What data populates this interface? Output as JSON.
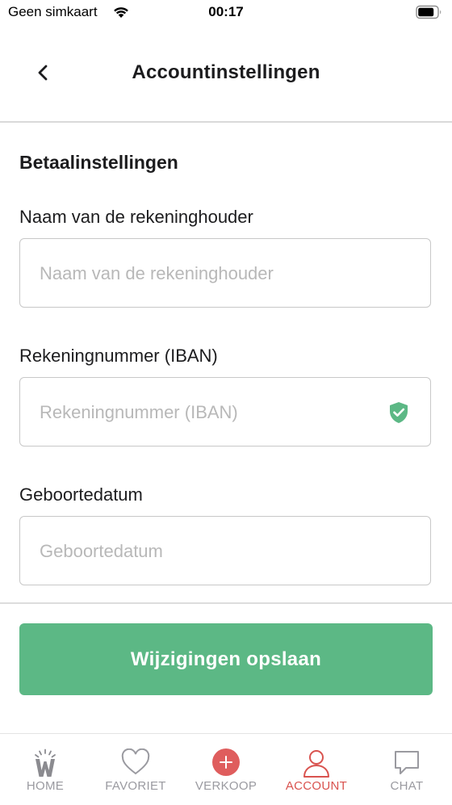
{
  "status_bar": {
    "carrier": "Geen simkaart",
    "time": "00:17"
  },
  "header": {
    "title": "Accountinstellingen",
    "back_icon": "chevron-left-icon"
  },
  "form": {
    "section_title": "Betaalinstellingen",
    "fields": [
      {
        "label": "Naam van de rekeninghouder",
        "placeholder": "Naam van de rekeninghouder",
        "value": ""
      },
      {
        "label": "Rekeningnummer (IBAN)",
        "placeholder": "Rekeningnummer (IBAN)",
        "value": "",
        "icon": "shield-check-icon"
      },
      {
        "label": "Geboortedatum",
        "placeholder": "Geboortedatum",
        "value": ""
      }
    ],
    "save_label": "Wijzigingen opslaan"
  },
  "tabs": [
    {
      "label": "HOME",
      "icon": "home-logo-icon",
      "active": false
    },
    {
      "label": "FAVORIET",
      "icon": "heart-icon",
      "active": false
    },
    {
      "label": "VERKOOP",
      "icon": "plus-circle-icon",
      "active": false
    },
    {
      "label": "ACCOUNT",
      "icon": "user-icon",
      "active": true
    },
    {
      "label": "CHAT",
      "icon": "chat-bubble-icon",
      "active": false
    }
  ],
  "colors": {
    "accent_green": "#5cb885",
    "active_red": "#d9534f",
    "inactive_gray": "#9a9aa0",
    "verkoop_red": "#df5d5d"
  }
}
